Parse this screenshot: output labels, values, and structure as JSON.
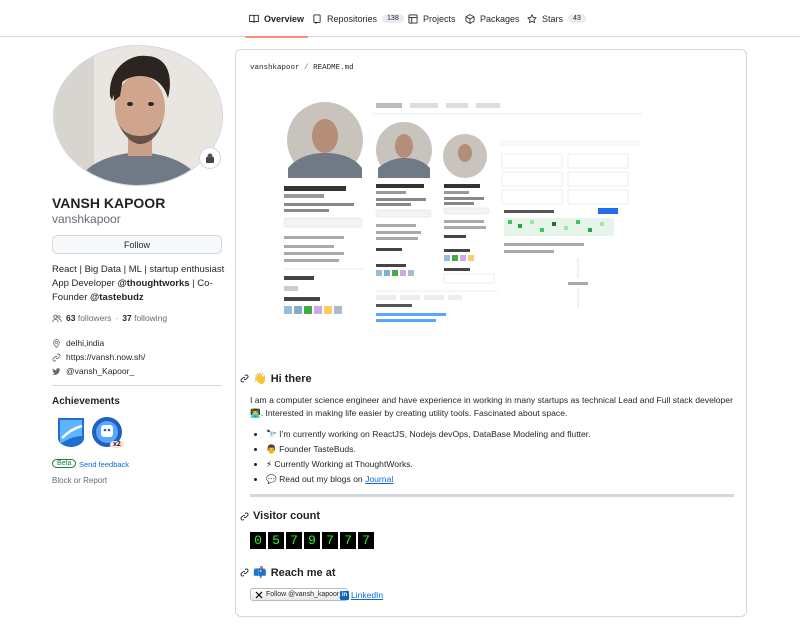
{
  "tabs": [
    {
      "label": "Overview",
      "count": "",
      "icon": "book-icon"
    },
    {
      "label": "Repositories",
      "count": "138",
      "icon": "repo-icon"
    },
    {
      "label": "Projects",
      "count": "",
      "icon": "table-icon"
    },
    {
      "label": "Packages",
      "count": "",
      "icon": "package-icon"
    },
    {
      "label": "Stars",
      "count": "43",
      "icon": "star-icon"
    }
  ],
  "profile": {
    "fullname": "VANSH KAPOOR",
    "username": "vanshkapoor",
    "follow_label": "Follow",
    "bio": {
      "line1": "React | Big Data | ML | startup enthusiast",
      "line2_pre": "App Developer ",
      "org1": "@thoughtworks",
      "line2_post": " | Co-",
      "line3_pre": "Founder ",
      "org2": "@tastebudz"
    },
    "followers": "63",
    "followers_label": "followers",
    "dot": "·",
    "following": "37",
    "following_label": "following",
    "location": "delhi,india",
    "website": "https://vansh.now.sh/",
    "twitter": "@vansh_Kapoor_",
    "achievements_title": "Achievements",
    "achievement_multiplier": "x2",
    "beta_label": "Beta",
    "feedback_label": "Send feedback",
    "block_label": "Block or Report"
  },
  "readme": {
    "path_owner": "vanshkapoor",
    "path_sep": "/",
    "path_file": "README.md",
    "hi_title": "Hi there",
    "intro": "I am a computer science engineer and have experience in working in many startups as technical Lead and Full stack developer👨‍💻. Interested in making life easier by creating utility tools. Fascinated about space.",
    "bullets": [
      "🔭 I’m currently working on ReactJS, Nodejs devOps, DataBase Modeling and flutter.",
      "👨 Founder TasteBuds.",
      "⚡ Currently Working at ThoughtWorks."
    ],
    "blog_text": "💬 Read out my blogs on ",
    "blog_link": "Journal",
    "visitor_title": "Visitor count",
    "visitor_digits": [
      "0",
      "5",
      "7",
      "9",
      "7",
      "7",
      "7"
    ],
    "reach_title": "Reach me at",
    "twitter_follow": "Follow @vansh_kapoor_",
    "linkedin": "LinkedIn"
  },
  "colors": {
    "accent_underline": "#fd8c73",
    "link": "#0969da",
    "counter_green": "#2ef02e"
  }
}
